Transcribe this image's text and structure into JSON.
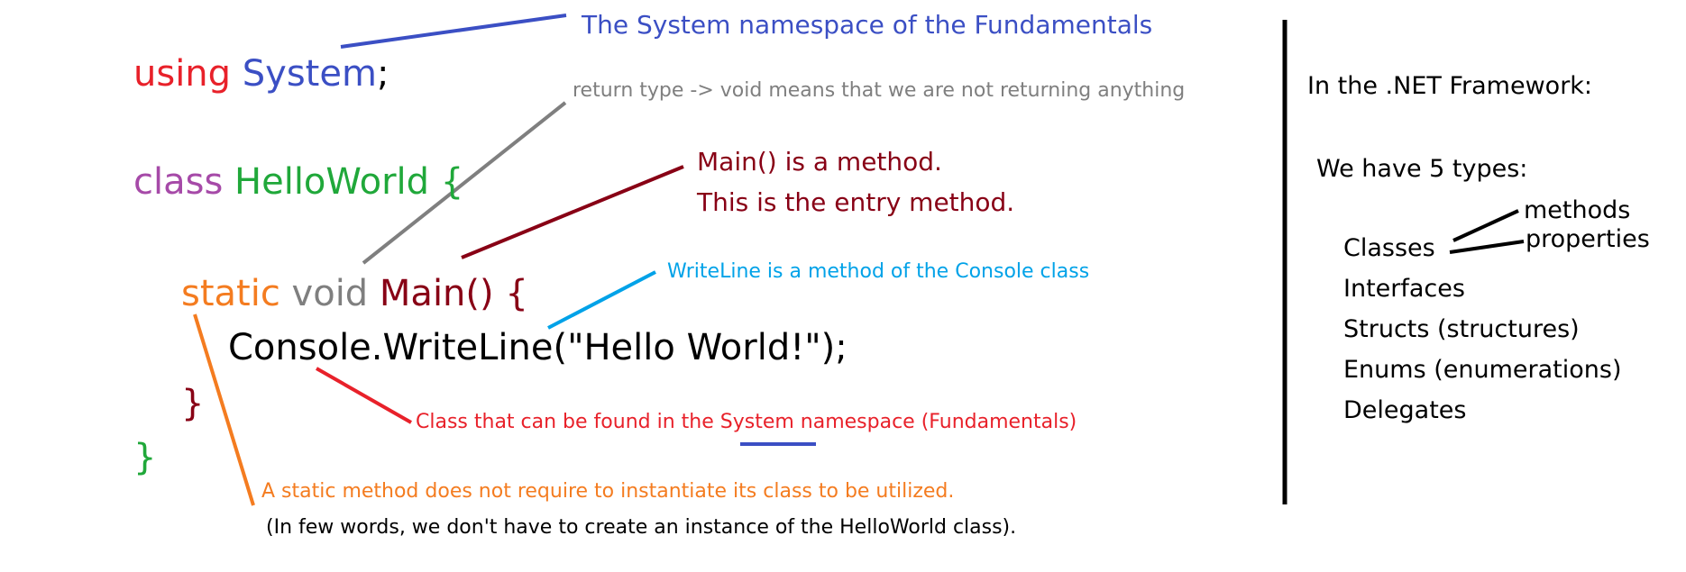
{
  "colors": {
    "keyword_using": "#e8212a",
    "namespace_blue": "#3b4fc4",
    "keyword_class": "#a64aa8",
    "class_green": "#20a83a",
    "static_orange": "#f47c20",
    "void_gray": "#7f7f7f",
    "main_darkred": "#880015",
    "console_blue": "#00a2e8",
    "black": "#000000"
  },
  "code": {
    "using_kw": "using",
    "system_ns": "System",
    "semicolon": ";",
    "class_kw": "class",
    "class_name": "HelloWorld",
    "open_brace_class": "{",
    "static_kw": "static",
    "void_kw": "void",
    "main_sig": "Main() {",
    "console_line": "Console.WriteLine(\"Hello World!\");",
    "close_brace_main": "}",
    "close_brace_class": "}"
  },
  "annotations": {
    "system_namespace": "The System namespace of the Fundamentals",
    "return_type": "return type -> void means that we are not returning anything",
    "main_line1": "Main() is a method.",
    "main_line2": "This is the entry method.",
    "writeline": "WriteLine is a method of the Console class",
    "class_found_prefix": "Class that can be found in the ",
    "class_found_system": "System",
    "class_found_suffix": " namespace (Fundamentals)",
    "static_line1": "A static method does not require to instantiate its class to be utilized.",
    "static_line2": "(In few words, we don't have to create an instance of the HelloWorld class)."
  },
  "framework_panel": {
    "title": "In the .NET Framework:",
    "types_heading": "We have 5 types:",
    "types": [
      "Classes",
      "Interfaces",
      "Structs (structures)",
      "Enums (enumerations)",
      "Delegates"
    ],
    "class_members": [
      "methods",
      "properties"
    ]
  }
}
